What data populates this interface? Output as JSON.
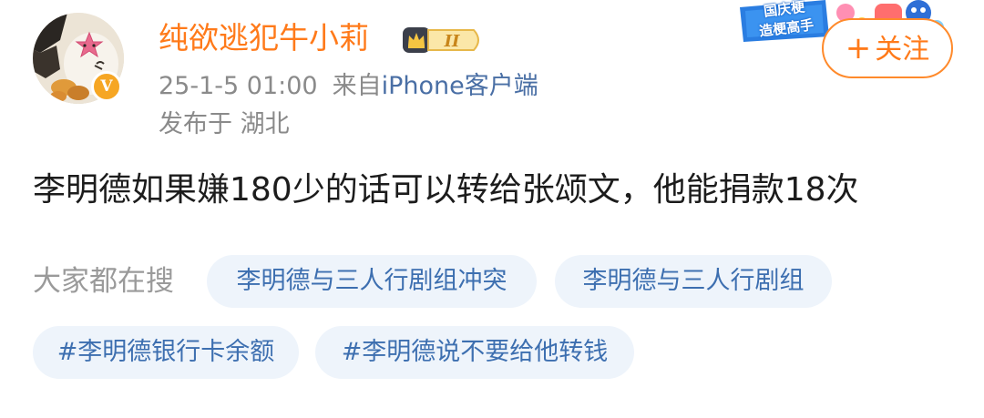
{
  "user": {
    "name": "纯欲逃犯牛小莉",
    "verified_mark": "V",
    "level_badge_label": "II",
    "level_badge_icon": "crown-icon",
    "avatar_icon": "avatar-image"
  },
  "post_meta": {
    "time": "25-1-5 01:00",
    "from_prefix": "来自",
    "source": "iPhone客户端",
    "location": "发布于 湖北"
  },
  "promo": {
    "line1": "国庆梗",
    "line2": "造梗高手"
  },
  "follow_button": {
    "plus": "+",
    "label": "关注"
  },
  "post": {
    "text": "李明德如果嫌180少的话可以转给张颂文，他能捐款18次"
  },
  "hot_search": {
    "label": "大家都在搜",
    "tags": [
      "李明德与三人行剧组冲突",
      "李明德与三人行剧组",
      "#李明德银行卡余额",
      "#李明德说不要给他转钱"
    ]
  },
  "colors": {
    "username": "#ff7a1a",
    "follow_border": "#ff8a2b",
    "source_link": "#4a6fa5",
    "tag_text": "#3d6fb0",
    "tag_bg": "#eef4fb",
    "meta_gray": "#8a8a8a",
    "verify_badge": "#f6a623"
  }
}
